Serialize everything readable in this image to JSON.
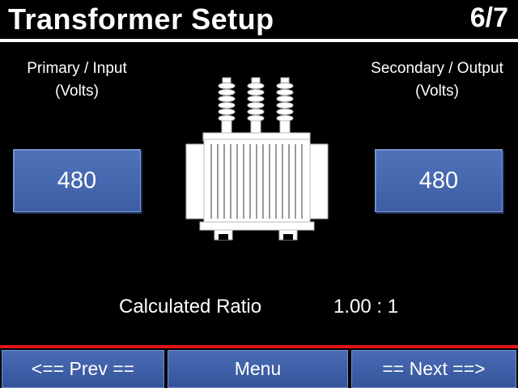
{
  "header": {
    "title": "Transformer Setup",
    "page": "6/7"
  },
  "primary": {
    "label_line1": "Primary / Input",
    "label_line2": "(Volts)",
    "value": "480"
  },
  "secondary": {
    "label_line1": "Secondary / Output",
    "label_line2": "(Volts)",
    "value": "480"
  },
  "ratio": {
    "label": "Calculated Ratio",
    "value": "1.00 : 1"
  },
  "footer": {
    "prev_label": "<== Prev ==",
    "menu_label": "Menu",
    "next_label": "== Next ==>"
  },
  "colors": {
    "background": "#000000",
    "button_blue": "#4a6cb5",
    "accent_red": "#e0141b",
    "text": "#ffffff"
  },
  "icons": {
    "transformer": "transformer-icon"
  }
}
